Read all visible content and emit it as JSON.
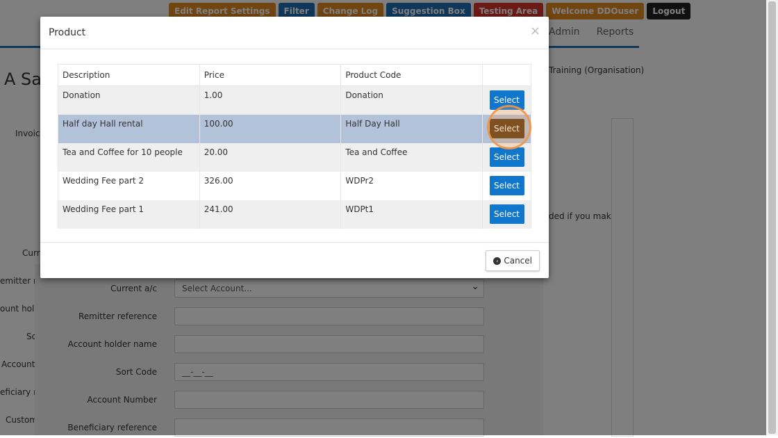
{
  "topnav": {
    "edit_report_settings": "Edit Report Settings",
    "filter": "Filter",
    "change_log": "Change Log",
    "suggestion_box": "Suggestion Box",
    "testing_area": "Testing Area",
    "welcome": "Welcome DDOuser",
    "logout": "Logout"
  },
  "menu": {
    "admin": "Admin",
    "reports": "Reports"
  },
  "page": {
    "title": "A Sa",
    "org_prefix": "Training",
    "org_suffix": "(Organisation)",
    "side_note": "ded if you make",
    "left_labels": [
      "Invoic",
      "Curr",
      "emitter re",
      "ount holde",
      "So",
      "Account N",
      "eficiary re",
      "Custom"
    ]
  },
  "form": {
    "current_ac": {
      "label": "Current a/c",
      "placeholder": "Select Account..."
    },
    "remitter_reference": {
      "label": "Remitter reference",
      "value": ""
    },
    "account_holder_name": {
      "label": "Account holder name",
      "value": ""
    },
    "sort_code": {
      "label": "Sort Code",
      "placeholder": "__-__-__"
    },
    "account_number": {
      "label": "Account Number",
      "value": ""
    },
    "beneficiary_reference": {
      "label": "Beneficiary reference",
      "value": ""
    }
  },
  "modal": {
    "title": "Product",
    "close_symbol": "×",
    "columns": [
      "Description",
      "Price",
      "Product Code",
      ""
    ],
    "rows": [
      {
        "description": "Donation",
        "price": "1.00",
        "code": "Donation",
        "action": "Select"
      },
      {
        "description": "Half day Hall rental",
        "price": "100.00",
        "code": "Half Day Hall",
        "action": "Select"
      },
      {
        "description": "Tea and Coffee for 10 people",
        "price": "20.00",
        "code": "Tea and Coffee",
        "action": "Select"
      },
      {
        "description": "Wedding Fee part 2",
        "price": "326.00",
        "code": "WDPr2",
        "action": "Select"
      },
      {
        "description": "Wedding Fee part 1",
        "price": "241.00",
        "code": "WDPt1",
        "action": "Select"
      }
    ],
    "cancel_label": "Cancel"
  },
  "colors": {
    "select_button": "#1177cc",
    "select_button_active": "#5a3a14",
    "highlight_row": "#b2c2d9",
    "nav_blue": "#1f6fb5",
    "nav_orange": "#e08a1e"
  }
}
